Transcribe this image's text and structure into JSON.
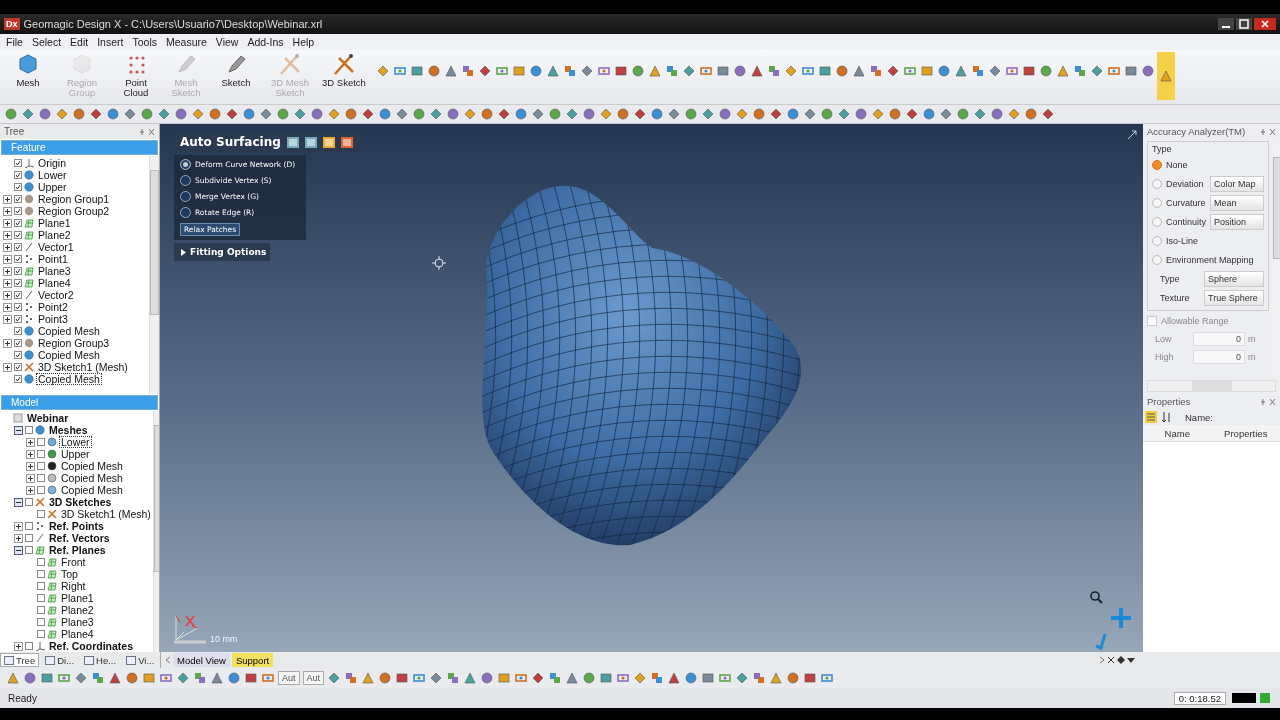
{
  "window": {
    "logo": "Dx",
    "title": "Geomagic Design X - C:\\Users\\Usuario7\\Desktop\\Webinar.xrl"
  },
  "menu": [
    "File",
    "Select",
    "Edit",
    "Insert",
    "Tools",
    "Measure",
    "View",
    "Add-Ins",
    "Help"
  ],
  "ribbon": [
    {
      "label": "Mesh",
      "kind": "mesh",
      "disabled": false
    },
    {
      "label": "Region Group",
      "kind": "region",
      "disabled": true
    },
    {
      "label": "Point Cloud",
      "kind": "points",
      "disabled": false
    },
    {
      "label": "Mesh Sketch",
      "kind": "pen",
      "disabled": true
    },
    {
      "label": "Sketch",
      "kind": "pen",
      "disabled": false
    },
    {
      "label": "3D Mesh Sketch",
      "kind": "sketch3d",
      "disabled": true
    },
    {
      "label": "3D Sketch",
      "kind": "sketch3d",
      "disabled": false
    }
  ],
  "tree_panel": {
    "title": "Tree",
    "header": "Feature",
    "items": [
      {
        "label": "Origin",
        "kind": "origin",
        "expandable": false,
        "expanded": false,
        "selected": false
      },
      {
        "label": "Lower",
        "kind": "mesh",
        "expandable": false,
        "expanded": false,
        "selected": false
      },
      {
        "label": "Upper",
        "kind": "mesh",
        "expandable": false,
        "expanded": false,
        "selected": false
      },
      {
        "label": "Region Group1",
        "kind": "region",
        "expandable": true,
        "expanded": false,
        "selected": false
      },
      {
        "label": "Region Group2",
        "kind": "region",
        "expandable": true,
        "expanded": false,
        "selected": false
      },
      {
        "label": "Plane1",
        "kind": "plane",
        "expandable": true,
        "expanded": false,
        "selected": false
      },
      {
        "label": "Plane2",
        "kind": "plane",
        "expandable": true,
        "expanded": false,
        "selected": false
      },
      {
        "label": "Vector1",
        "kind": "vector",
        "expandable": true,
        "expanded": false,
        "selected": false
      },
      {
        "label": "Point1",
        "kind": "point",
        "expandable": true,
        "expanded": false,
        "selected": false
      },
      {
        "label": "Plane3",
        "kind": "plane",
        "expandable": true,
        "expanded": false,
        "selected": false
      },
      {
        "label": "Plane4",
        "kind": "plane",
        "expandable": true,
        "expanded": false,
        "selected": false
      },
      {
        "label": "Vector2",
        "kind": "vector",
        "expandable": true,
        "expanded": false,
        "selected": false
      },
      {
        "label": "Point2",
        "kind": "point",
        "expandable": true,
        "expanded": false,
        "selected": false
      },
      {
        "label": "Point3",
        "kind": "point",
        "expandable": true,
        "expanded": false,
        "selected": false
      },
      {
        "label": "Copied Mesh",
        "kind": "mesh",
        "expandable": false,
        "expanded": false,
        "selected": false
      },
      {
        "label": "Region Group3",
        "kind": "region",
        "expandable": true,
        "expanded": false,
        "selected": false
      },
      {
        "label": "Copied Mesh",
        "kind": "mesh",
        "expandable": false,
        "expanded": false,
        "selected": false
      },
      {
        "label": "3D Sketch1 (Mesh)",
        "kind": "sketch",
        "expandable": true,
        "expanded": false,
        "selected": false
      },
      {
        "label": "Copied Mesh",
        "kind": "mesh",
        "expandable": false,
        "expanded": false,
        "selected": true
      }
    ]
  },
  "model_panel": {
    "header": "Model",
    "items": [
      {
        "label": "Webinar",
        "kind": "model",
        "expandable": false,
        "expanded": false,
        "selected": false,
        "children": [
          {
            "label": "Meshes",
            "kind": "mesh",
            "expandable": true,
            "expanded": true,
            "selected": false,
            "children": [
              {
                "label": "Lower",
                "kind": "dot",
                "color": "#6fa8dc",
                "expandable": true,
                "expanded": false,
                "selected": true
              },
              {
                "label": "Upper",
                "kind": "dot",
                "color": "#3a9a4a",
                "expandable": true,
                "expanded": false,
                "selected": false
              },
              {
                "label": "Copied Mesh",
                "kind": "dot",
                "color": "#222222",
                "expandable": true,
                "expanded": false,
                "selected": false
              },
              {
                "label": "Copied Mesh",
                "kind": "dot",
                "color": "#bbbbbb",
                "expandable": true,
                "expanded": false,
                "selected": false
              },
              {
                "label": "Copied Mesh",
                "kind": "dot",
                "color": "#7fb0e0",
                "expandable": true,
                "expanded": false,
                "selected": false
              }
            ]
          },
          {
            "label": "3D Sketches",
            "kind": "sketch",
            "expandable": true,
            "expanded": true,
            "selected": false,
            "children": [
              {
                "label": "3D Sketch1 (Mesh)",
                "kind": "sketch",
                "expandable": false,
                "expanded": false,
                "selected": false
              }
            ]
          },
          {
            "label": "Ref. Points",
            "kind": "point",
            "expandable": true,
            "expanded": false,
            "selected": false
          },
          {
            "label": "Ref. Vectors",
            "kind": "vector",
            "expandable": true,
            "expanded": false,
            "selected": false
          },
          {
            "label": "Ref. Planes",
            "kind": "plane",
            "expandable": true,
            "expanded": true,
            "selected": false,
            "children": [
              {
                "label": "Front",
                "kind": "plane",
                "expandable": false,
                "expanded": false,
                "selected": false
              },
              {
                "label": "Top",
                "kind": "plane",
                "expandable": false,
                "expanded": false,
                "selected": false
              },
              {
                "label": "Right",
                "kind": "plane",
                "expandable": false,
                "expanded": false,
                "selected": false
              },
              {
                "label": "Plane1",
                "kind": "plane",
                "expandable": false,
                "expanded": false,
                "selected": false
              },
              {
                "label": "Plane2",
                "kind": "plane",
                "expandable": false,
                "expanded": false,
                "selected": false
              },
              {
                "label": "Plane3",
                "kind": "plane",
                "expandable": false,
                "expanded": false,
                "selected": false
              },
              {
                "label": "Plane4",
                "kind": "plane",
                "expandable": false,
                "expanded": false,
                "selected": false
              }
            ]
          },
          {
            "label": "Ref. Coordinates",
            "kind": "origin",
            "expandable": true,
            "expanded": false,
            "selected": false
          }
        ]
      }
    ]
  },
  "panel_tabs": [
    {
      "label": "Tree",
      "selected": true
    },
    {
      "label": "Di...",
      "selected": false
    },
    {
      "label": "He...",
      "selected": false
    },
    {
      "label": "Vi...",
      "selected": false
    }
  ],
  "auto_surfacing": {
    "title": "Auto Surfacing",
    "options": [
      {
        "label": "Deform Curve Network (D)",
        "selected": true
      },
      {
        "label": "Subdivide Vertex (S)",
        "selected": false
      },
      {
        "label": "Merge Vertex (G)",
        "selected": false
      },
      {
        "label": "Rotate Edge (R)",
        "selected": false
      }
    ],
    "button": "Relax Patches",
    "section": {
      "label": "Fitting Options",
      "expanded": false
    }
  },
  "viewport": {
    "scale": "10 mm"
  },
  "view_tabs": [
    {
      "label": "Model View",
      "selected": false
    },
    {
      "label": "Support",
      "selected": true
    }
  ],
  "accuracy_analyzer": {
    "title": "Accuracy Analyzer(TM)",
    "group": "Type",
    "options": [
      {
        "label": "None",
        "selected": true
      },
      {
        "label": "Deviation",
        "selected": false,
        "dropdown": "Color Map"
      },
      {
        "label": "Curvature",
        "selected": false,
        "dropdown": "Mean"
      },
      {
        "label": "Continuity",
        "selected": false,
        "dropdown": "Position"
      },
      {
        "label": "Iso-Line",
        "selected": false
      },
      {
        "label": "Environment Mapping",
        "selected": false
      }
    ],
    "mapping_fields": [
      {
        "label": "Type",
        "value": "Sphere"
      },
      {
        "label": "Texture",
        "value": "True Sphere"
      }
    ],
    "allowable_range": {
      "label": "Allowable Range",
      "checked": false
    },
    "range_fields": [
      {
        "label": "Low",
        "value": "0",
        "unit": "m"
      },
      {
        "label": "High",
        "value": "0",
        "unit": "m"
      }
    ]
  },
  "properties": {
    "title": "Properties",
    "name_label": "Name:",
    "columns": [
      "Name",
      "Properties"
    ]
  },
  "bottom_toolbar": {
    "dropdowns": [
      "Aut",
      "Aut"
    ]
  },
  "status_bar": {
    "text": "Ready",
    "time": "0: 0:18.52"
  }
}
